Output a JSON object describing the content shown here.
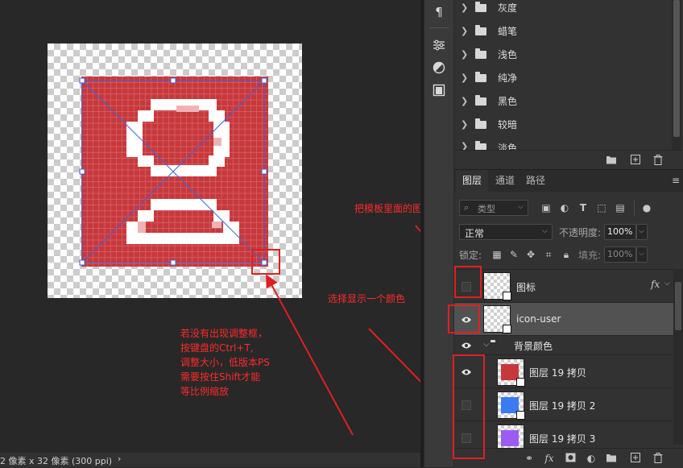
{
  "status_bar": {
    "text": "2 像素 x 32 像素 (300 ppi)",
    "arrow": "›"
  },
  "adjustments": {
    "items": [
      {
        "label": "灰度"
      },
      {
        "label": "蜡笔"
      },
      {
        "label": "浅色"
      },
      {
        "label": "纯净"
      },
      {
        "label": "黑色"
      },
      {
        "label": "较暗"
      },
      {
        "label": "淡色"
      }
    ]
  },
  "layers_panel": {
    "tabs": [
      "图层",
      "通道",
      "路径"
    ],
    "filter_placeholder": "类型",
    "blend_mode": "正常",
    "opacity_label": "不透明度:",
    "opacity_value": "100%",
    "lock_label": "锁定:",
    "fill_label": "填充:",
    "fill_value": "100%",
    "fx_label": "fx",
    "layers": [
      {
        "name": "图标",
        "visible": false
      },
      {
        "name": "icon-user",
        "visible": true
      },
      {
        "name": "背景颜色",
        "visible": true,
        "group": true
      },
      {
        "name": "图层 19 拷贝",
        "visible": true,
        "color": "#c7383c"
      },
      {
        "name": "图层 19 拷贝 2",
        "visible": false,
        "color": "#3b7bf2"
      },
      {
        "name": "图层 19 拷贝 3",
        "visible": false,
        "color": "#9c5cf2"
      }
    ]
  },
  "annotations": {
    "hide_icon": "把模板里面的图标隐藏",
    "choose_color": "选择显示一个颜色",
    "transform_help": [
      "若没有出现调整框，",
      "按键盘的Ctrl+T,",
      "调整大小，低版本PS",
      "需要按住Shift才能",
      "等比例缩放"
    ]
  },
  "colors": {
    "icon_red": "#c7383c",
    "annotation_red": "#ff2a2a",
    "panel_bg": "#323232"
  }
}
